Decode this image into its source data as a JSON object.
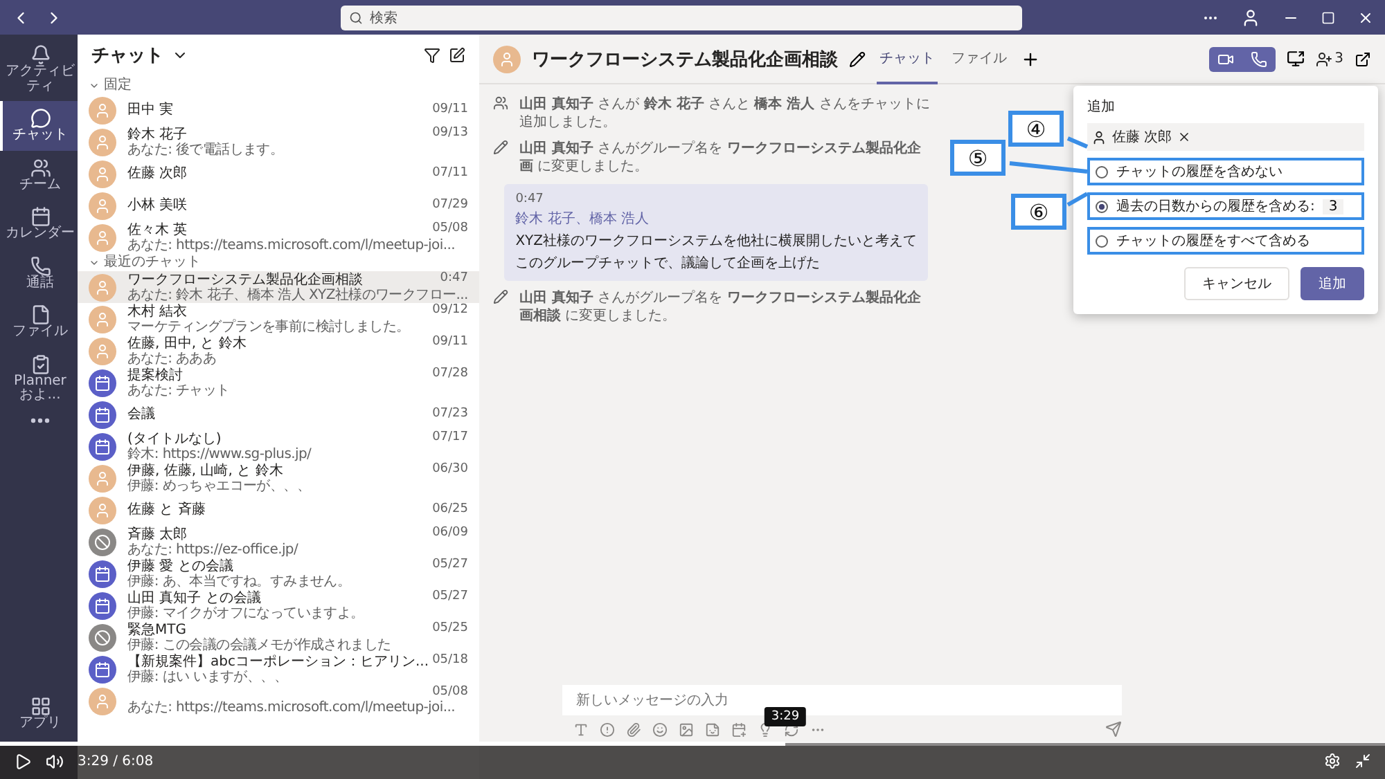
{
  "title_bar": {
    "search_placeholder": "検索"
  },
  "rail": [
    {
      "kind": "activity",
      "label": "アクティビティ",
      "selected": false
    },
    {
      "kind": "chat",
      "label": "チャット",
      "selected": true
    },
    {
      "kind": "teams",
      "label": "チーム",
      "selected": false
    },
    {
      "kind": "calendar",
      "label": "カレンダー",
      "selected": false
    },
    {
      "kind": "calls",
      "label": "通話",
      "selected": false
    },
    {
      "kind": "files",
      "label": "ファイル",
      "selected": false
    },
    {
      "kind": "planner",
      "label": "Planner およ...",
      "selected": false
    },
    {
      "kind": "more",
      "selected": false
    }
  ],
  "rail_bottom": {
    "kind": "apps",
    "label": "アプリ"
  },
  "chat_list": {
    "title": "チャット",
    "sections": [
      {
        "title": "固定",
        "items": [
          {
            "kind": "person",
            "name": "田中 実",
            "time": "09/11",
            "selected": false
          },
          {
            "kind": "person",
            "name": "鈴木 花子",
            "time": "09/13",
            "preview": "あなた: 後で電話します。",
            "selected": false
          },
          {
            "kind": "person",
            "name": "佐藤 次郎",
            "time": "07/11",
            "selected": false
          },
          {
            "kind": "person",
            "name": "小林 美咲",
            "time": "07/29",
            "selected": false
          },
          {
            "kind": "person",
            "name": "佐々木 英",
            "time": "05/08",
            "preview": "あなた: https://teams.microsoft.com/l/meetup-joi...",
            "selected": false
          }
        ]
      },
      {
        "title": "最近のチャット",
        "items": [
          {
            "kind": "person",
            "name": "ワークフローシステム製品化企画相談",
            "time": "0:47",
            "preview": "あなた: 鈴木 花子、橋本 浩人 XYZ社様のワークフロー...",
            "selected": true
          },
          {
            "kind": "person",
            "name": "木村 結衣",
            "time": "09/12",
            "preview": "マーケティングプランを事前に検討しました。",
            "selected": false
          },
          {
            "kind": "person",
            "name": "佐藤, 田中, と 鈴木",
            "time": "09/11",
            "preview": "あなた: あああ",
            "selected": false
          },
          {
            "kind": "meeting",
            "name": "提案検討",
            "time": "07/28",
            "preview": "あなた: チャット",
            "selected": false
          },
          {
            "kind": "meeting",
            "name": "会議",
            "time": "07/23",
            "selected": false
          },
          {
            "kind": "meeting",
            "name": "(タイトルなし)",
            "time": "07/17",
            "preview": "鈴木: https://www.sg-plus.jp/",
            "selected": false
          },
          {
            "kind": "person",
            "name": "伊藤, 佐藤, 山崎, と 鈴木",
            "time": "06/30",
            "preview": "伊藤: めっちゃエコーが、、、",
            "selected": false
          },
          {
            "kind": "person",
            "name": "佐藤 と 斉藤",
            "time": "06/25",
            "selected": false
          },
          {
            "kind": "blocked",
            "name": "斉藤 太郎",
            "time": "06/09",
            "preview": "あなた: https://ez-office.jp/",
            "selected": false
          },
          {
            "kind": "meeting",
            "name": "伊藤 愛 との会議",
            "time": "05/27",
            "preview": "伊藤: あ、本当ですね。すみません。",
            "selected": false
          },
          {
            "kind": "meeting",
            "name": "山田 真知子 との会議",
            "time": "05/27",
            "preview": "伊藤: マイクがオフになっていますよ。",
            "selected": false
          },
          {
            "kind": "blocked",
            "name": "緊急MTG",
            "time": "05/25",
            "preview": "伊藤: この会議の会議メモが作成されました",
            "selected": false
          },
          {
            "kind": "meeting",
            "name": "【新規案件】abcコーポレーション：ヒアリン...",
            "time": "05/18",
            "preview": "伊藤: はい いますが、、、",
            "selected": false
          },
          {
            "kind": "person",
            "time": "05/08",
            "preview": "あなた: https://teams.microsoft.com/l/meetup-joi...",
            "selected": false
          }
        ]
      }
    ]
  },
  "header": {
    "title": "ワークフローシステム製品化企画相談",
    "tabs": [
      {
        "label": "チャット",
        "selected": true
      },
      {
        "label": "ファイル",
        "selected": false
      }
    ],
    "people_count": "3"
  },
  "messages": [
    {
      "kind": "added",
      "text": "**山田 真知子** さんが **鈴木 花子** さんと **橋本 浩人** さんをチャットに追加しました。"
    },
    {
      "kind": "renamed",
      "text": "**山田 真知子** さんがグループ名を **ワークフローシステム製品化企画** に変更しました。"
    },
    {
      "kind": "bubble",
      "time": "0:47",
      "mentions": "鈴木 花子、橋本 浩人",
      "lines": [
        "XYZ社様のワークフローシステムを他社に横展開したいと考えて",
        "このグループチャットで、議論して企画を上げた"
      ]
    },
    {
      "kind": "renamed",
      "text": "**山田 真知子** さんがグループ名を **ワークフローシステム製品化企画相談** に変更しました。"
    }
  ],
  "compose": {
    "placeholder": "新しいメッセージの入力"
  },
  "dialog": {
    "label": "追加",
    "person": "佐藤 次郎",
    "options": [
      {
        "label": "チャットの履歴を含めない",
        "selected": false
      },
      {
        "label": "過去の日数からの履歴を含める:",
        "selected": true,
        "days": "3"
      },
      {
        "label": "チャットの履歴をすべて含める",
        "selected": false
      }
    ],
    "buttons": [
      {
        "kind": "secondary",
        "label": "キャンセル"
      },
      {
        "kind": "primary",
        "label": "追加"
      }
    ]
  },
  "callouts": [
    "④",
    "⑤",
    "⑥"
  ],
  "video": {
    "time": "3:29 / 6:08",
    "tooltip": "3:29",
    "level": 0.567
  }
}
